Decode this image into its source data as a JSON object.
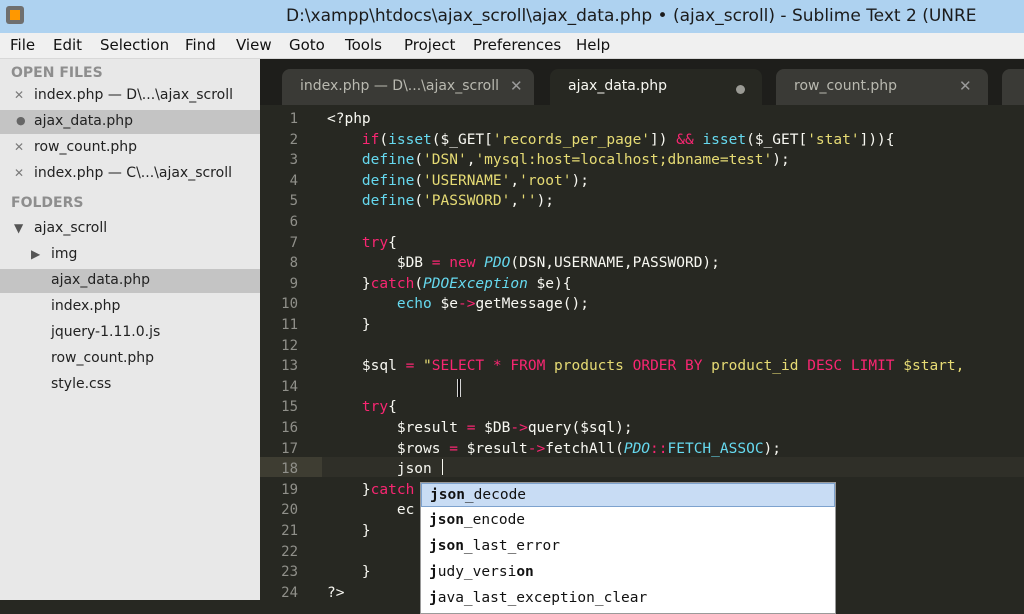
{
  "window": {
    "title": "D:\\xampp\\htdocs\\ajax_scroll\\ajax_data.php • (ajax_scroll) - Sublime Text 2 (UNRE"
  },
  "menu": [
    "File",
    "Edit",
    "Selection",
    "Find",
    "View",
    "Goto",
    "Tools",
    "Project",
    "Preferences",
    "Help"
  ],
  "sidebar": {
    "open_files_heading": "OPEN FILES",
    "open_files": [
      {
        "label": "index.php — D\\...\\ajax_scroll",
        "icon": "close-icon"
      },
      {
        "label": "ajax_data.php",
        "icon": "dot-icon"
      },
      {
        "label": "row_count.php",
        "icon": "close-icon"
      },
      {
        "label": "index.php — C\\...\\ajax_scroll",
        "icon": "close-icon"
      }
    ],
    "folders_heading": "FOLDERS",
    "folder": "ajax_scroll",
    "subfolder": "img",
    "files": [
      "ajax_data.php",
      "index.php",
      "jquery-1.11.0.js",
      "row_count.php",
      "style.css"
    ]
  },
  "tabs": [
    {
      "label": "index.php — D\\...\\ajax_scroll"
    },
    {
      "label": "ajax_data.php"
    },
    {
      "label": "row_count.php"
    }
  ],
  "line_numbers": [
    "1",
    "2",
    "3",
    "4",
    "5",
    "6",
    "7",
    "8",
    "9",
    "10",
    "11",
    "12",
    "13",
    "14",
    "15",
    "16",
    "17",
    "18",
    "19",
    "20",
    "21",
    "22",
    "23",
    "24"
  ],
  "autocomplete": {
    "typed": "json",
    "items": [
      {
        "match": "json",
        "rest": "_decode"
      },
      {
        "match": "json",
        "rest": "_encode"
      },
      {
        "match": "json",
        "rest": "_last_error"
      },
      {
        "match": "j",
        "rest": "udy_versi",
        "match2": "on",
        "rest2": ""
      },
      {
        "match": "j",
        "rest": "ava_last_exception_clear"
      }
    ]
  },
  "colors": {
    "keyword": "#f92672",
    "builtin": "#66d9ef",
    "string": "#e6db74",
    "type": "#a6e22e",
    "bg": "#272822"
  }
}
